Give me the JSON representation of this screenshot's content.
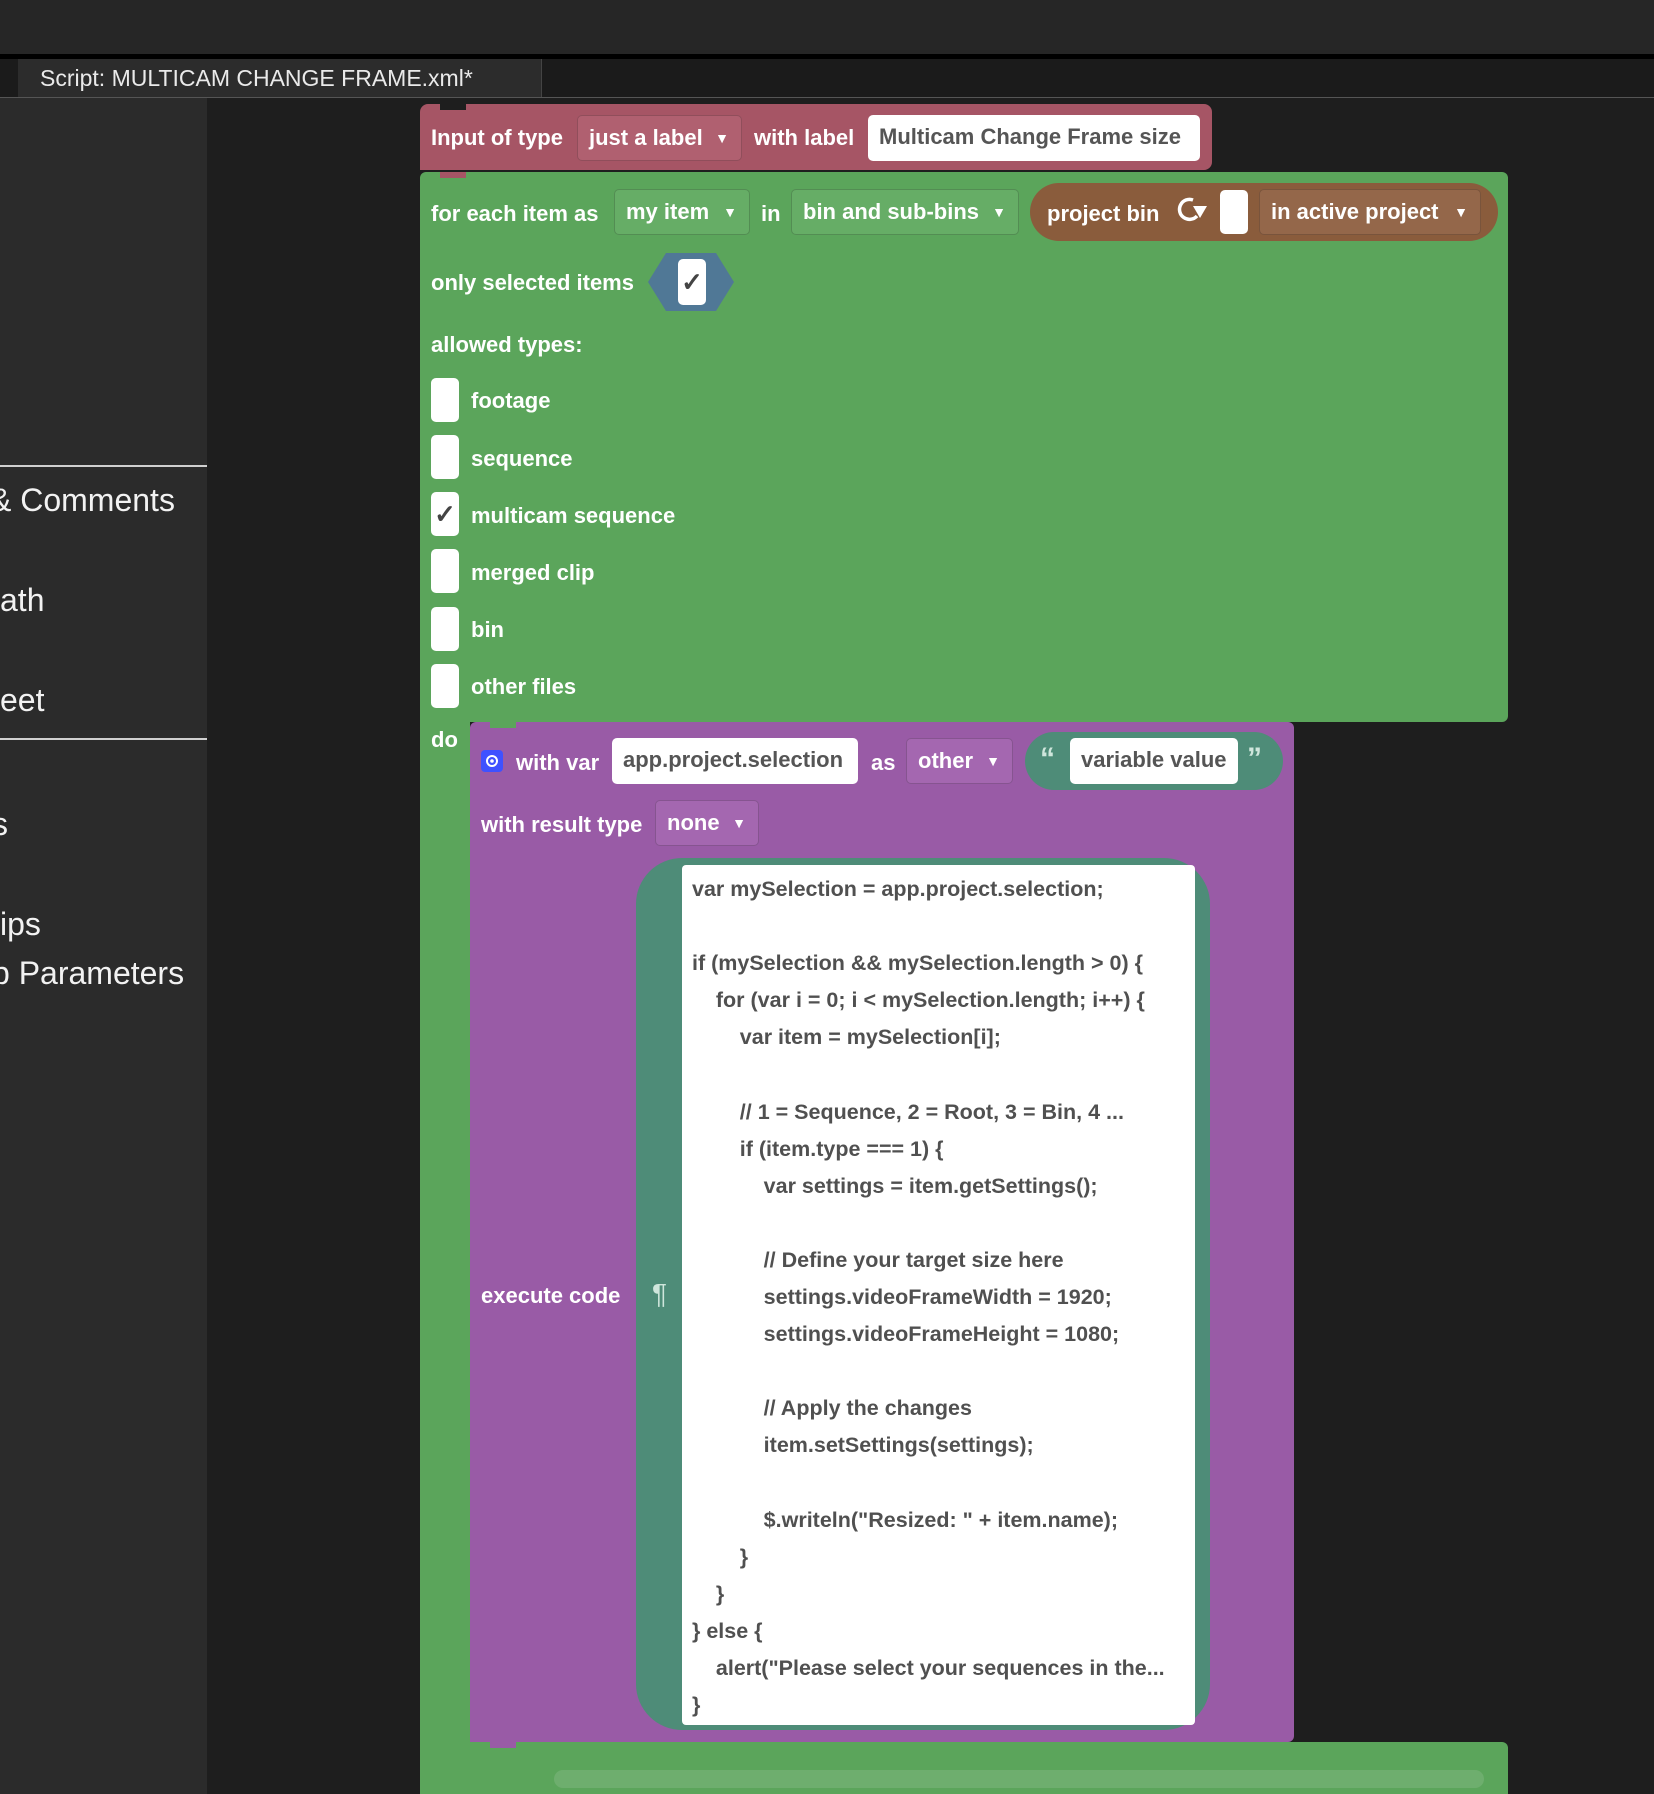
{
  "tab": {
    "title": "Script: MULTICAM CHANGE FRAME.xml*"
  },
  "sidebar": {
    "items": [
      "& Comments",
      "ath",
      "eet",
      "s",
      "ips",
      "p Parameters"
    ]
  },
  "input_block": {
    "label": "Input of type",
    "type_value": "just a label",
    "with_label": "with label",
    "label_value": "Multicam Change Frame size"
  },
  "foreach": {
    "label": "for each item as",
    "var_value": "my item",
    "in_label": "in",
    "scope_value": "bin and sub-bins",
    "only_selected_label": "only selected items",
    "only_selected_checked": "✓",
    "allowed_types_label": "allowed types:",
    "types": [
      {
        "label": "footage",
        "mark": ""
      },
      {
        "label": "sequence",
        "mark": ""
      },
      {
        "label": "multicam sequence",
        "mark": "✓"
      },
      {
        "label": "merged clip",
        "mark": ""
      },
      {
        "label": "bin",
        "mark": ""
      },
      {
        "label": "other files",
        "mark": ""
      }
    ],
    "do_label": "do"
  },
  "project_bin": {
    "label": "project bin",
    "scope_value": "in active project"
  },
  "withvar": {
    "label": "with var",
    "var_name": "app.project.selection",
    "as_label": "as",
    "type_value": "other",
    "open_quote": "“",
    "value": "variable value",
    "close_quote": "”",
    "result_label": "with result type",
    "result_value": "none",
    "execute_label": "execute code",
    "pilcrow": "¶",
    "code": "var mySelection = app.project.selection;\n\nif (mySelection && mySelection.length > 0) {\n    for (var i = 0; i < mySelection.length; i++) {\n        var item = mySelection[i];\n\n        // 1 = Sequence, 2 = Root, 3 = Bin, 4 ...\n        if (item.type === 1) {\n            var settings = item.getSettings();\n\n            // Define your target size here\n            settings.videoFrameWidth = 1920;\n            settings.videoFrameHeight = 1080;\n\n            // Apply the changes\n            item.setSettings(settings);\n\n            $.writeln(\"Resized: \" + item.name);\n        }\n    }\n} else {\n    alert(\"Please select your sequences in the...\n}"
  },
  "colors": {
    "input_block": "#a65565",
    "loop_block": "#5ba55b",
    "project_bin_block": "#8a5c3c",
    "var_block": "#995ba6",
    "text_block": "#4e8c78"
  }
}
